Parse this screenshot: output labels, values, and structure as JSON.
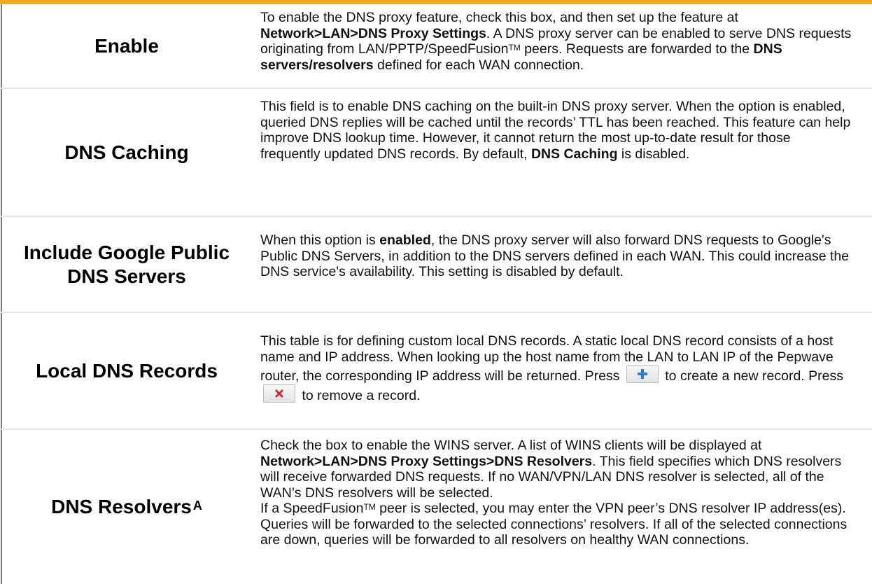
{
  "rows": [
    {
      "label": "Enable",
      "desc": {
        "t1": "To enable the DNS proxy feature, check this box, and then set up the feature at ",
        "b1": "Network>LAN>DNS Proxy Settings",
        "t2": ". A DNS proxy server can be enabled to serve DNS requests originating from LAN/PPTP/SpeedFusion",
        "sup": "TM",
        "t3": " peers. Requests are forwarded to the ",
        "b2": "DNS servers/resolvers",
        "t4": " defined for each WAN connection."
      }
    },
    {
      "label": "DNS Caching",
      "desc": {
        "t1": "This field is to enable DNS caching on the built-in DNS proxy server. When the option is enabled, queried DNS replies will be cached until the records’ TTL has been reached. This feature can help improve DNS lookup time. However, it cannot return the most up-to-date result for those frequently updated DNS records. By default, ",
        "b1": "DNS Caching",
        "t2": " is disabled."
      }
    },
    {
      "label": "Include Google Public DNS Servers",
      "desc": {
        "t1": "When this option is ",
        "b1": "enabled",
        "t2": ", the DNS proxy server will also forward DNS requests to Google's Public DNS Servers, in addition to the DNS servers defined in each WAN. This could increase the DNS service's availability. This setting is disabled by default."
      }
    },
    {
      "label": "Local DNS Records",
      "desc": {
        "t1": "This table is for defining custom local DNS records. A static local DNS record consists of a host name and IP address. When looking up the host name from the LAN to LAN IP of the Pepwave router, the corresponding IP address will be returned. Press",
        "t2": "to create a new record. Press",
        "t3": "to remove a record."
      }
    },
    {
      "label": "DNS Resolvers",
      "label_sup": "A",
      "desc": {
        "t1": "Check the box to enable the WINS server. A list of WINS clients will be displayed at ",
        "b1": "Network>LAN>DNS Proxy Settings>DNS Resolvers",
        "t2": ". This field specifies which DNS resolvers will receive forwarded DNS requests. If no WAN/VPN/LAN DNS resolver is selected, all of the WAN’s DNS resolvers will be selected.",
        "t3": "If a SpeedFusion",
        "sup": "TM",
        "t4": " peer is selected, you may enter the VPN peer’s DNS resolver IP address(es). Queries will be forwarded to the selected connections’ resolvers. If all of the selected connections are down, queries will be forwarded to all resolvers on healthy WAN connections."
      }
    }
  ],
  "icons": [
    "add-icon",
    "delete-icon"
  ],
  "colors": {
    "top_bar": "#f5a623",
    "add": "#2f7fd0",
    "delete": "#d9261c"
  }
}
